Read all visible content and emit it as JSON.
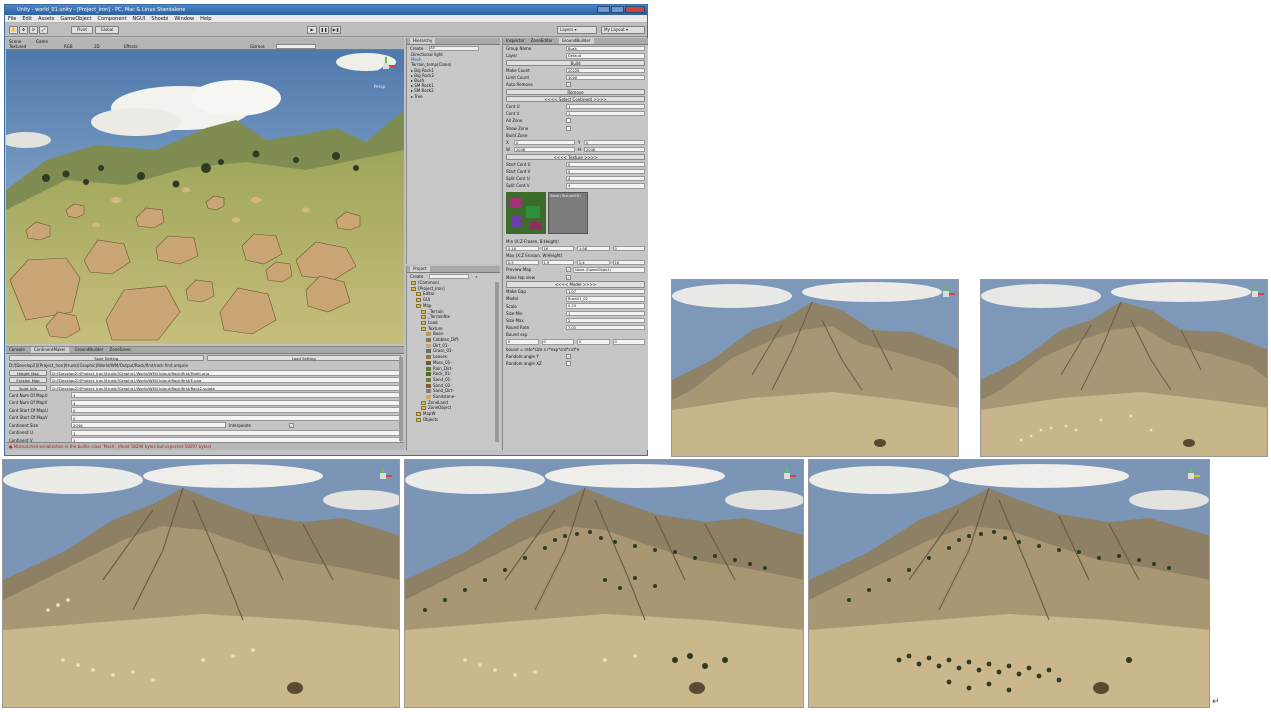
{
  "window": {
    "title": "Unity - world_01.unity - [Project_Iron] - PC, Mac & Linux Standalone",
    "menu": [
      "File",
      "Edit",
      "Assets",
      "GameObject",
      "Component",
      "NGUI",
      "Shoebi",
      "Window",
      "Help"
    ]
  },
  "toolbar": {
    "pivot_label": "Pivot",
    "global_label": "Global",
    "layers_label": "Layers",
    "layout_label": "My Layout"
  },
  "scene_panel": {
    "tabs": [
      "Scene",
      "Game"
    ],
    "textured": "Textured",
    "rgb": "RGB",
    "mode_2d": "2D",
    "effects": "Effects",
    "gizmos": "Gizmos",
    "persp": "Persp"
  },
  "hierarchy": {
    "tab": "Hierarchy",
    "create": "Create",
    "search_placeholder": "All",
    "items": [
      "Directional light",
      "Mesh",
      "Terrain_temp(Clone)",
      "Big Rock1",
      "Big Rock2",
      "Bush",
      "SM Rock1",
      "SM Rock2",
      "Tree"
    ]
  },
  "project": {
    "tab": "Project",
    "create": "Create",
    "items": [
      {
        "label": "(Common)",
        "depth": 0
      },
      {
        "label": "[Project_Iron]",
        "depth": 0
      },
      {
        "label": "Editor",
        "depth": 1
      },
      {
        "label": "GUI",
        "depth": 1
      },
      {
        "label": "Map",
        "depth": 1
      },
      {
        "label": "_Terrain",
        "depth": 2
      },
      {
        "label": "_Terrainfbx",
        "depth": 2
      },
      {
        "label": "Load",
        "depth": 2
      },
      {
        "label": "Texture",
        "depth": 2
      },
      {
        "label": "Base-",
        "depth": 3
      },
      {
        "label": "Cobbles_Diff-",
        "depth": 3
      },
      {
        "label": "Dirt_01-",
        "depth": 3
      },
      {
        "label": "Grass_01-",
        "depth": 3
      },
      {
        "label": "Leaves-",
        "depth": 3
      },
      {
        "label": "Moss_01-",
        "depth": 3
      },
      {
        "label": "Rain_Dirt-",
        "depth": 3
      },
      {
        "label": "Rock_01-",
        "depth": 3
      },
      {
        "label": "Sand_01-",
        "depth": 3
      },
      {
        "label": "Sand_02-",
        "depth": 3
      },
      {
        "label": "Sand_Dirt-",
        "depth": 3
      },
      {
        "label": "Sandstone-",
        "depth": 3
      },
      {
        "label": "ZoneLand",
        "depth": 2
      },
      {
        "label": "ZoneObject",
        "depth": 2
      },
      {
        "label": "MapW",
        "depth": 1
      },
      {
        "label": "Objects",
        "depth": 1
      }
    ]
  },
  "inspector": {
    "tabs": [
      "Inspector",
      "ZoneEditor",
      "GroundBuilder"
    ],
    "group_name_label": "Group Name",
    "group_name_value": "Bush",
    "layer_label": "Layer",
    "layer_value": "Default",
    "build_button": "Build",
    "make_count_label": "Make Count",
    "make_count_value": "20226",
    "limit_count_label": "Limit Count",
    "limit_count_value": "3000",
    "auto_remove_label": "Auto Remove",
    "remove_button": "Remove",
    "select_continent_button": "<<<< Select Continent >>>>",
    "cont_u_label": "Cont U",
    "cont_u_value": "1",
    "cont_v_label": "Cont V",
    "cont_v_value": "1",
    "all_zone_label": "All Zone",
    "show_zone_label": "Show Zone",
    "build_zone_label": "Build Zone",
    "build_zone_x": "0",
    "build_zone_y": "0",
    "build_zone_w": "2048",
    "build_zone_h": "2048",
    "texture_button": "<<<< Texture >>>>",
    "start_cont_u_label": "Start Cont U",
    "start_cont_u_value": "0",
    "start_cont_v_label": "Start Cont V",
    "start_cont_v_value": "0",
    "split_cont_u_label": "Split Cont U",
    "split_cont_u_value": "4",
    "split_cont_v_label": "Split Cont V",
    "split_cont_v_value": "4",
    "texture_caption": "None (Texture2D)",
    "min_label": "Min (X:Z-Frozen, B:Height)",
    "min_values": [
      "0.18",
      "16",
      "1.98",
      "0"
    ],
    "max_label": "Max (X:Z Erosion, W:Height)",
    "max_values": [
      "0.5",
      "1.9",
      "2.4",
      "16"
    ],
    "preview_map_label": "Preview Map",
    "preview_map_value": "None (GameObject)",
    "move_top_view_label": "Move top view",
    "model_button": "<<<< Model >>>>",
    "make_gap_label": "Make Gap",
    "make_gap_value": "1.07",
    "model_label": "Model",
    "model_value": "Bush01_02",
    "scale_label": "Scale",
    "scale_value": "0.23",
    "size_min_label": "Size Min",
    "size_min_value": "1",
    "size_max_label": "Size Max",
    "size_max_value": "2",
    "round_rate_label": "Round Rate",
    "round_rate_value": "7.05",
    "bound_exp_label": "Bound exp",
    "bound_exp_values": [
      "0",
      "0",
      "0",
      "0"
    ],
    "bound_formula": "bound = rate*size x r*exp*crd*crd*e",
    "random_angle_y_label": "Random angle Y",
    "random_angle_xz_label": "Random angle XZ"
  },
  "bottom_panel": {
    "tabs": [
      "Console",
      "ContinentMaker",
      "GroundBuilder",
      "ZoneSaver"
    ],
    "save_setting": "Save Setting",
    "load_setting": "Load Setting",
    "path_top": "D:/[Develop2]/[Project_Iron]/trunk/[Graphic]/World/WM/Output/Rock/first/rock first.xmprie",
    "height_map_button": "Height Map",
    "height_map_path": "D:/[Develop2]/[Project_Iron]/trunk/[Graphic]/World/WM/Output/Rock/first/Hight.png",
    "erosion_map_button": "Erosion Map",
    "erosion_map_path": "D:/[Develop2]/[Project_Iron]/trunk/[Graphic]/World/WM/Output/Rock/first/E.png",
    "splat_info_button": "Splat Info",
    "splat_info_path": "D:/[Develop2]/[Project_Iron]/trunk/[Graphic]/World/WM/Output/Rock/first/Rock2.splate",
    "rows": [
      {
        "label": "Cont Num Of MapU",
        "value": "4"
      },
      {
        "label": "Cont Num Of MapV",
        "value": "4"
      },
      {
        "label": "Cont Start Of MapU",
        "value": "0"
      },
      {
        "label": "Cont Start Of MapV",
        "value": "0"
      }
    ],
    "continent_size_label": "Continent Size",
    "continent_size_value": "2048",
    "interpolate_label": "Interpolate",
    "continent_u_label": "Continent U",
    "continent_u_value": "1",
    "continent_v_label": "Continent V",
    "continent_v_value": "1",
    "status": "Mismatched serialization in the builtin class 'Mesh'. (Read 58290 bytes but expected 58297 bytes)"
  },
  "colors": {
    "sky_top": "#6f8fb5",
    "sand": "#c9b58a",
    "grass": "#8d9a4c",
    "gizmo_green": "#5cc44a",
    "gizmo_red": "#d9413a",
    "gizmo_yellow": "#e3c52a"
  },
  "cursor_mark": "↵"
}
